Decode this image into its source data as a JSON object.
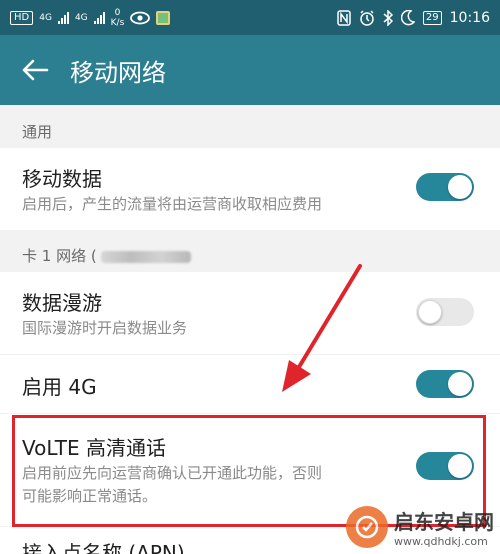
{
  "status_bar": {
    "hd": "HD",
    "sig1": "4G",
    "sig2": "4G",
    "net_speed_value": "0",
    "net_speed_unit": "K/s",
    "battery": "29",
    "time": "10:16"
  },
  "header": {
    "title": "移动网络"
  },
  "sections": {
    "general": "通用",
    "sim1_prefix": "卡 1 网络 ("
  },
  "settings": {
    "mobile_data": {
      "label": "移动数据",
      "desc": "启用后，产生的流量将由运营商收取相应费用",
      "enabled": true
    },
    "data_roaming": {
      "label": "数据漫游",
      "desc": "国际漫游时开启数据业务",
      "enabled": false
    },
    "enable_4g": {
      "label": "启用 4G",
      "enabled": true
    },
    "volte": {
      "label": "VoLTE 高清通话",
      "desc_line1": "启用前应先向运营商确认已开通此功能，否则",
      "desc_line2": "可能影响正常通话。",
      "enabled": true
    },
    "apn": {
      "label": "接入点名称 (APN)"
    }
  },
  "watermark": {
    "name": "启东安卓网",
    "url": "www.qdhdkj.com"
  },
  "colors": {
    "appbar": "#2b7f91",
    "toggle_on": "#26879b",
    "annotation": "#e0242b"
  }
}
